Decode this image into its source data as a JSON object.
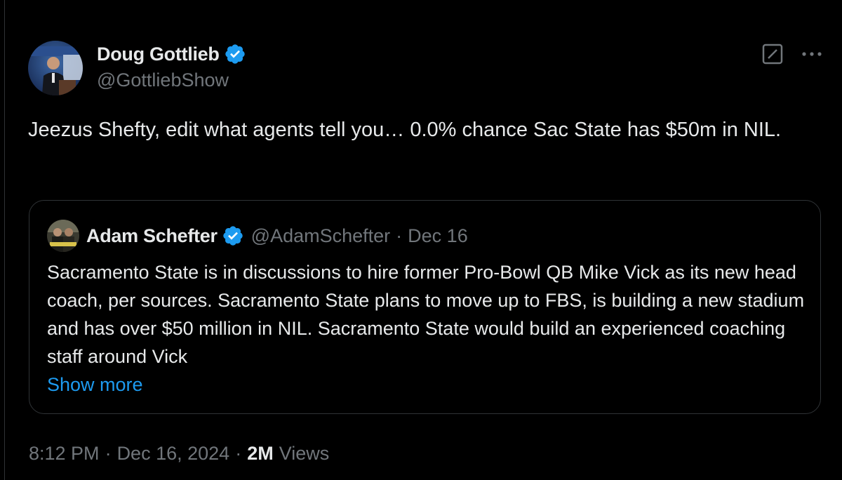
{
  "tweet": {
    "author": {
      "display_name": "Doug Gottlieb",
      "handle": "@GottliebShow",
      "verified": true
    },
    "text": "Jeezus Shefty, edit what agents tell you… 0.0% chance Sac State has $50m in NIL.",
    "time": "8:12 PM",
    "separator": "·",
    "date": "Dec 16, 2024",
    "views_count": "2M",
    "views_label": "Views"
  },
  "quote": {
    "author": {
      "display_name": "Adam Schefter",
      "handle": "@AdamSchefter",
      "verified": true
    },
    "separator": "·",
    "date": "Dec 16",
    "text": "Sacramento State is in discussions to hire former Pro-Bowl QB Mike Vick as its new head coach, per sources. Sacramento State plans to move up to FBS, is building a new stadium and has over $50 million in NIL. Sacramento State would build an experienced coaching staff around Vick",
    "show_more": "Show more"
  },
  "icons": {
    "verified": "verified-badge-icon",
    "grok": "grok-icon",
    "more": "more-options-icon"
  },
  "colors": {
    "background": "#000000",
    "text_primary": "#e7e9ea",
    "text_secondary": "#71767b",
    "accent": "#1d9bf0",
    "border": "#2f3336"
  }
}
